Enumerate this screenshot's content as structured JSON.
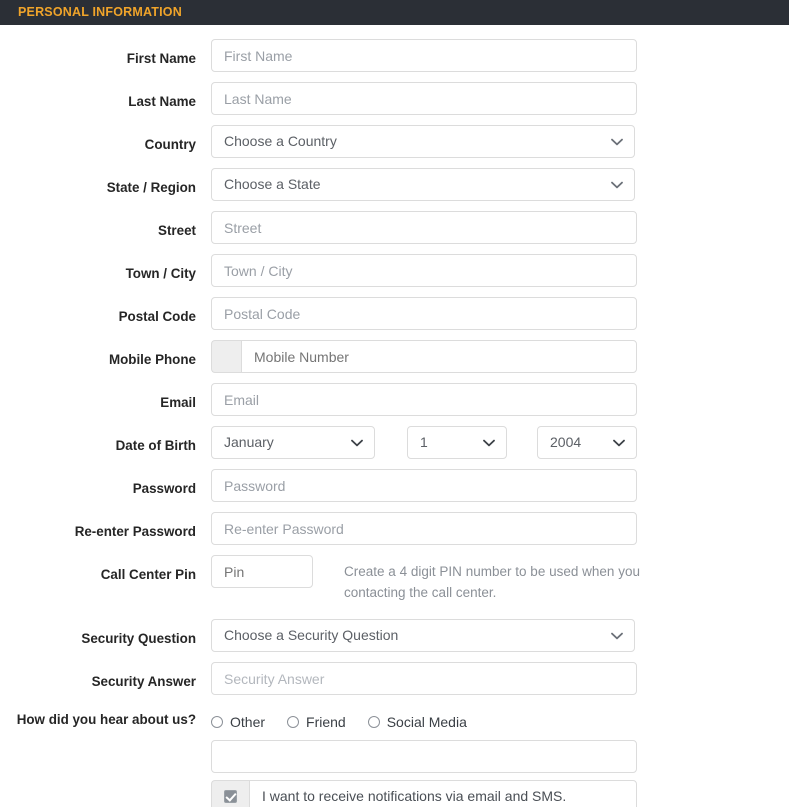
{
  "header": {
    "title": "PERSONAL INFORMATION"
  },
  "labels": {
    "first_name": "First Name",
    "last_name": "Last Name",
    "country": "Country",
    "state_region": "State / Region",
    "street": "Street",
    "town_city": "Town / City",
    "postal_code": "Postal Code",
    "mobile_phone": "Mobile Phone",
    "email": "Email",
    "date_of_birth": "Date of Birth",
    "password": "Password",
    "re_enter_password": "Re-enter Password",
    "call_center_pin": "Call Center Pin",
    "security_question": "Security Question",
    "security_answer": "Security Answer",
    "how_did_you_hear": "How did you hear about us?"
  },
  "fields": {
    "first_name": {
      "value": "",
      "placeholder": "First Name"
    },
    "last_name": {
      "value": "",
      "placeholder": "Last Name"
    },
    "country": {
      "selected": "Choose a Country"
    },
    "state_region": {
      "selected": "Choose a State"
    },
    "street": {
      "value": "",
      "placeholder": "Street"
    },
    "town_city": {
      "value": "",
      "placeholder": "Town / City"
    },
    "postal_code": {
      "value": "",
      "placeholder": "Postal Code"
    },
    "mobile_phone": {
      "prefix": "",
      "value": "",
      "placeholder": "Mobile Number"
    },
    "email": {
      "value": "",
      "placeholder": "Email"
    },
    "dob_month": {
      "selected": "January"
    },
    "dob_day": {
      "selected": "1"
    },
    "dob_year": {
      "selected": "2004"
    },
    "password": {
      "value": "",
      "placeholder": "Password"
    },
    "re_enter_password": {
      "value": "",
      "placeholder": "Re-enter Password"
    },
    "call_center_pin": {
      "value": "",
      "placeholder": "Pin"
    },
    "call_center_pin_help": "Create a 4 digit PIN number to be used when you contacting the call center.",
    "security_question": {
      "selected": "Choose a Security Question"
    },
    "security_answer": {
      "value": "",
      "placeholder": "Security Answer"
    },
    "how_did_you_hear_other": {
      "value": "",
      "placeholder": ""
    }
  },
  "radios": {
    "options": [
      {
        "label": "Other",
        "checked": false
      },
      {
        "label": "Friend",
        "checked": false
      },
      {
        "label": "Social Media",
        "checked": false
      }
    ]
  },
  "notifications": {
    "checked": true,
    "text": "I want to receive notifications via email and SMS."
  },
  "icons": {
    "chevron_down": "chevron-down-icon",
    "check": "check-icon"
  },
  "colors": {
    "header_bg": "#2b2f36",
    "header_text": "#f0a42a",
    "border": "#dcdcdc",
    "label_text": "#262626",
    "placeholder": "#9a9fa6",
    "help_text": "#8b9097",
    "addon_bg": "#eeeeee"
  }
}
